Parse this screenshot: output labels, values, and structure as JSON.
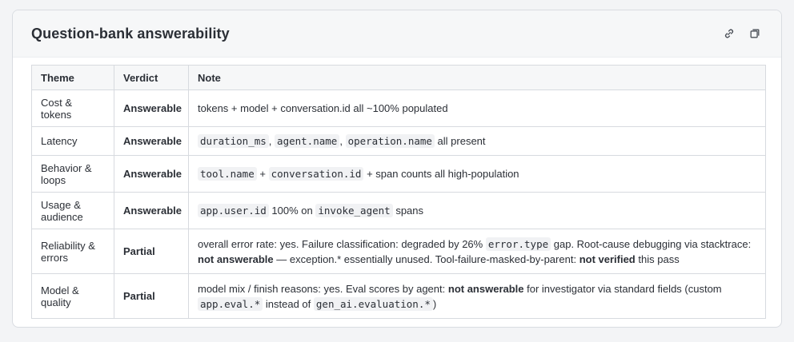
{
  "card": {
    "title": "Question-bank answerability",
    "icons": [
      "link-icon",
      "copy-icon"
    ]
  },
  "table": {
    "headers": [
      "Theme",
      "Verdict",
      "Note"
    ],
    "rows": [
      {
        "theme": "Cost & tokens",
        "verdict": "Answerable",
        "note": {
          "t1": "tokens + model + conversation.id all ~100% populated"
        }
      },
      {
        "theme": "Latency",
        "verdict": "Answerable",
        "note": {
          "c1": "duration_ms",
          "s1": ",",
          "c2": "agent.name",
          "s2": ",",
          "c3": "operation.name",
          "t1": "all present"
        }
      },
      {
        "theme": "Behavior & loops",
        "verdict": "Answerable",
        "note": {
          "c1": "tool.name",
          "s1": "+",
          "c2": "conversation.id",
          "t1": "+ span counts all high-population"
        }
      },
      {
        "theme": "Usage & audience",
        "verdict": "Answerable",
        "note": {
          "c1": "app.user.id",
          "t1": "100% on",
          "c2": "invoke_agent",
          "t2": "spans"
        }
      },
      {
        "theme": "Reliability & errors",
        "verdict": "Partial",
        "note": {
          "t1": "overall error rate: yes. Failure classification: degraded by 26%",
          "c1": "error.type",
          "t2": "gap. Root-cause debugging via stacktrace:",
          "b1": "not answerable",
          "t3": "— exception.* essentially unused. Tool-failure-masked-by-parent:",
          "b2": "not verified",
          "t4": "this pass"
        }
      },
      {
        "theme": "Model & quality",
        "verdict": "Partial",
        "note": {
          "t1": "model mix / finish reasons: yes. Eval scores by agent:",
          "b1": "not answerable",
          "t2": "for investigator via standard fields (custom",
          "c1": "app.eval.*",
          "t3": "instead of",
          "c2": "gen_ai.evaluation.*",
          "t4": ")"
        }
      }
    ]
  }
}
